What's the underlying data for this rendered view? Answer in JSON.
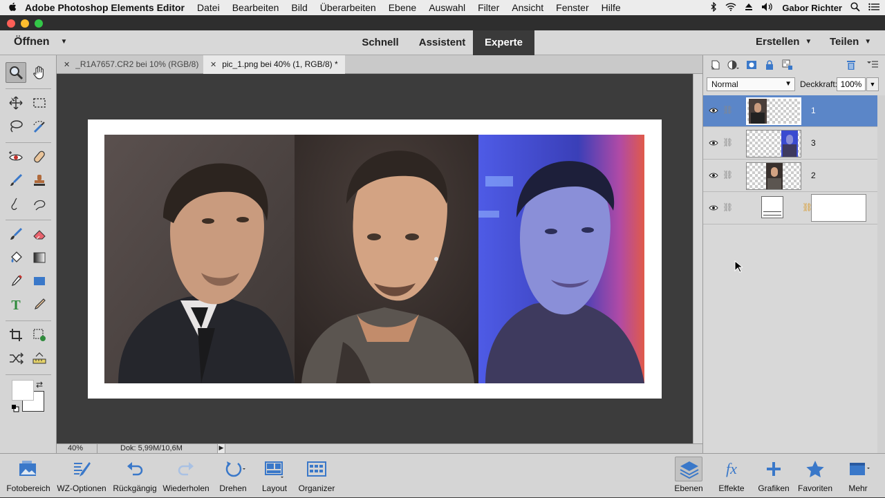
{
  "menubar": {
    "app": "Adobe Photoshop Elements Editor",
    "items": [
      "Datei",
      "Bearbeiten",
      "Bild",
      "Überarbeiten",
      "Ebene",
      "Auswahl",
      "Filter",
      "Ansicht",
      "Fenster",
      "Hilfe"
    ],
    "user": "Gabor Richter"
  },
  "modebar": {
    "open_label": "Öffnen",
    "tabs": [
      "Schnell",
      "Assistent",
      "Experte"
    ],
    "active_tab": "Experte",
    "create_label": "Erstellen",
    "share_label": "Teilen"
  },
  "doc_tabs": [
    {
      "label": "_R1A7657.CR2 bei 10% (RGB/8)",
      "active": false
    },
    {
      "label": "pic_1.png bei 40% (1, RGB/8) *",
      "active": true
    }
  ],
  "status": {
    "zoom": "40%",
    "doc_size": "Dok: 5,99M/10,6M"
  },
  "layers_panel": {
    "blend_mode": "Normal",
    "opacity_label": "Deckkraft:",
    "opacity_value": "100%",
    "layers": [
      {
        "name": "1",
        "selected": true
      },
      {
        "name": "3",
        "selected": false
      },
      {
        "name": "2",
        "selected": false
      },
      {
        "name": "",
        "selected": false
      }
    ]
  },
  "taskbar": {
    "left": [
      "Fotobereich",
      "WZ-Optionen",
      "Rückgängig",
      "Wiederholen",
      "Drehen",
      "Layout",
      "Organizer"
    ],
    "right": [
      "Ebenen",
      "Effekte",
      "Grafiken",
      "Favoriten",
      "Mehr"
    ]
  },
  "colors": {
    "accent": "#5b86c8",
    "panel": "#d8d8d8",
    "canvas_bg": "#3c3c3c",
    "icon_blue": "#3a78c9"
  }
}
